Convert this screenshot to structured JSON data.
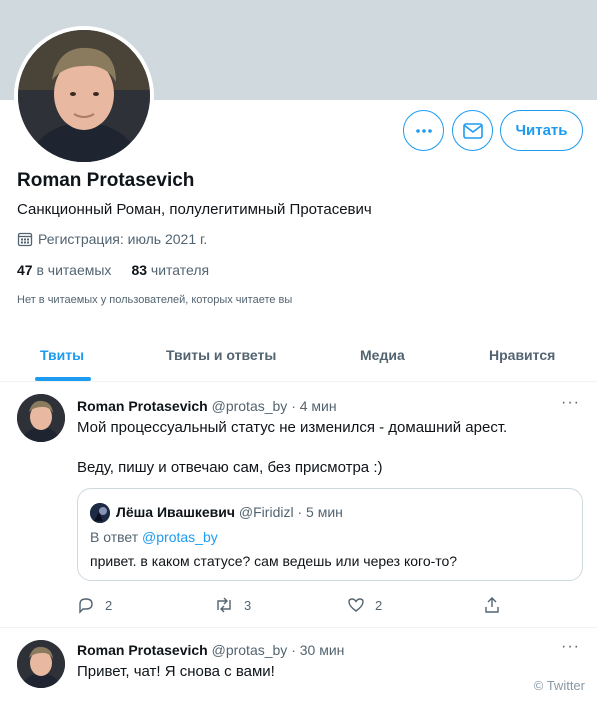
{
  "profile": {
    "name": "Roman Protasevich",
    "bio": "Санкционный Роман, полулегитимный Протасевич",
    "joined": "Регистрация: июль 2021 г.",
    "following_count": "47",
    "following_label": "в читаемых",
    "followers_count": "83",
    "followers_label": "читателя",
    "no_follows_note": "Нет в читаемых у пользователей, которых читаете вы",
    "follow_button": "Читать"
  },
  "tabs": [
    {
      "label": "Твиты",
      "active": true
    },
    {
      "label": "Твиты и ответы",
      "active": false
    },
    {
      "label": "Медиа",
      "active": false
    },
    {
      "label": "Нравится",
      "active": false
    }
  ],
  "tweets": [
    {
      "name": "Roman Protasevich",
      "meta": "@protas_by · 4 мин",
      "line1": "Мой процессуальный статус не изменился - домашний арест.",
      "line2": "Веду, пишу и отвечаю сам, без присмотра :)",
      "quote": {
        "name": "Лёша Ивашкевич",
        "meta": "@Firidizl · 5 мин",
        "reply_prefix": "В ответ",
        "reply_to": "@protas_by",
        "text": "привет. в каком статусе? сам ведешь или через кого-то?"
      },
      "replies": "2",
      "retweets": "3",
      "likes": "2"
    },
    {
      "name": "Roman Protasevich",
      "meta": "@protas_by · 30 мин",
      "line1": "Привет, чат! Я снова с вами!"
    }
  ],
  "watermark": "© Twitter",
  "colors": {
    "accent": "#1d9bf0",
    "banner": "#cfd9de",
    "muted": "#536471"
  }
}
